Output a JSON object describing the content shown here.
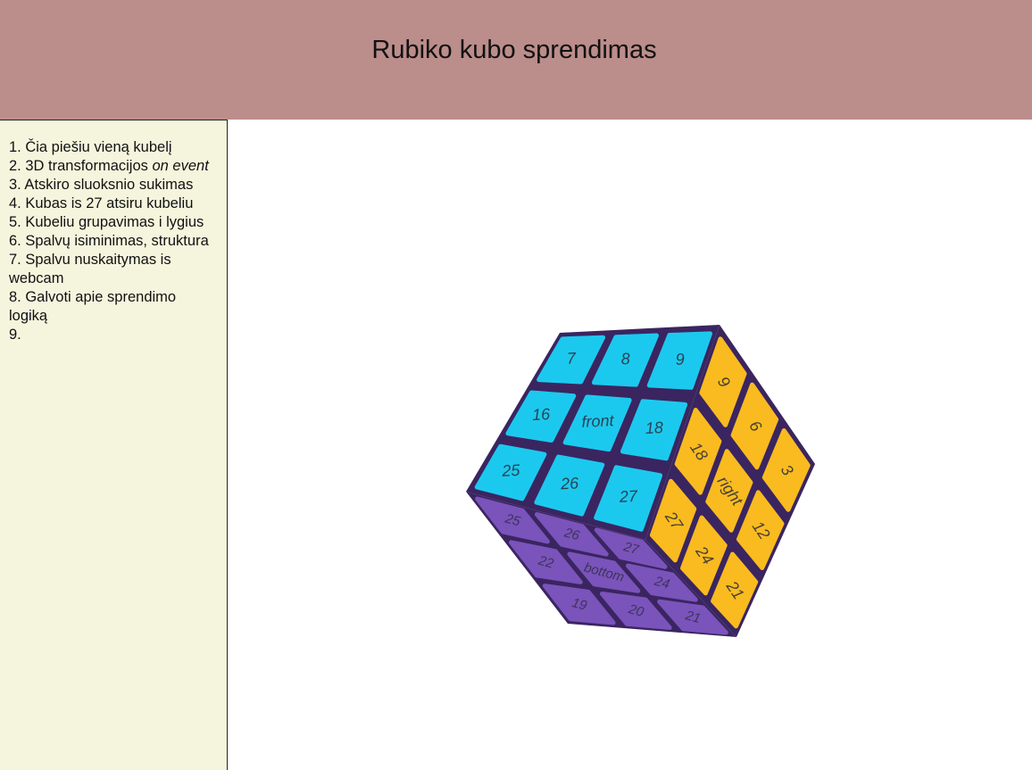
{
  "header": {
    "title": "Rubiko kubo sprendimas"
  },
  "sidebar": {
    "items": [
      {
        "text": "1. Čia piešiu vieną kubelį",
        "em": ""
      },
      {
        "text": "2. 3D transformacijos ",
        "em": "on event"
      },
      {
        "text": "3. Atskiro sluoksnio sukimas",
        "em": ""
      },
      {
        "text": "4. Kubas is 27 atsiru kubeliu",
        "em": ""
      },
      {
        "text": "5. Kubeliu grupavimas i lygius",
        "em": ""
      },
      {
        "text": "6. Spalvų isiminimas, struktura",
        "em": ""
      },
      {
        "text": "7. Spalvu nuskaitymas is webcam",
        "em": ""
      },
      {
        "text": "8. Galvoti apie sprendimo logiką",
        "em": ""
      },
      {
        "text": "9.",
        "em": ""
      }
    ]
  },
  "cube": {
    "colors": {
      "front": "#1cc9ee",
      "right": "#f9bb1f",
      "bottom": "#7a53bb",
      "edge": "#3a2560"
    },
    "faces": {
      "front": [
        "7",
        "8",
        "9",
        "16",
        "front",
        "18",
        "25",
        "26",
        "27"
      ],
      "right": [
        "9",
        "6",
        "3",
        "18",
        "right",
        "12",
        "27",
        "24",
        "21"
      ],
      "bottom": [
        "25",
        "26",
        "27",
        "22",
        "bottom",
        "24",
        "19",
        "20",
        "21"
      ]
    }
  }
}
